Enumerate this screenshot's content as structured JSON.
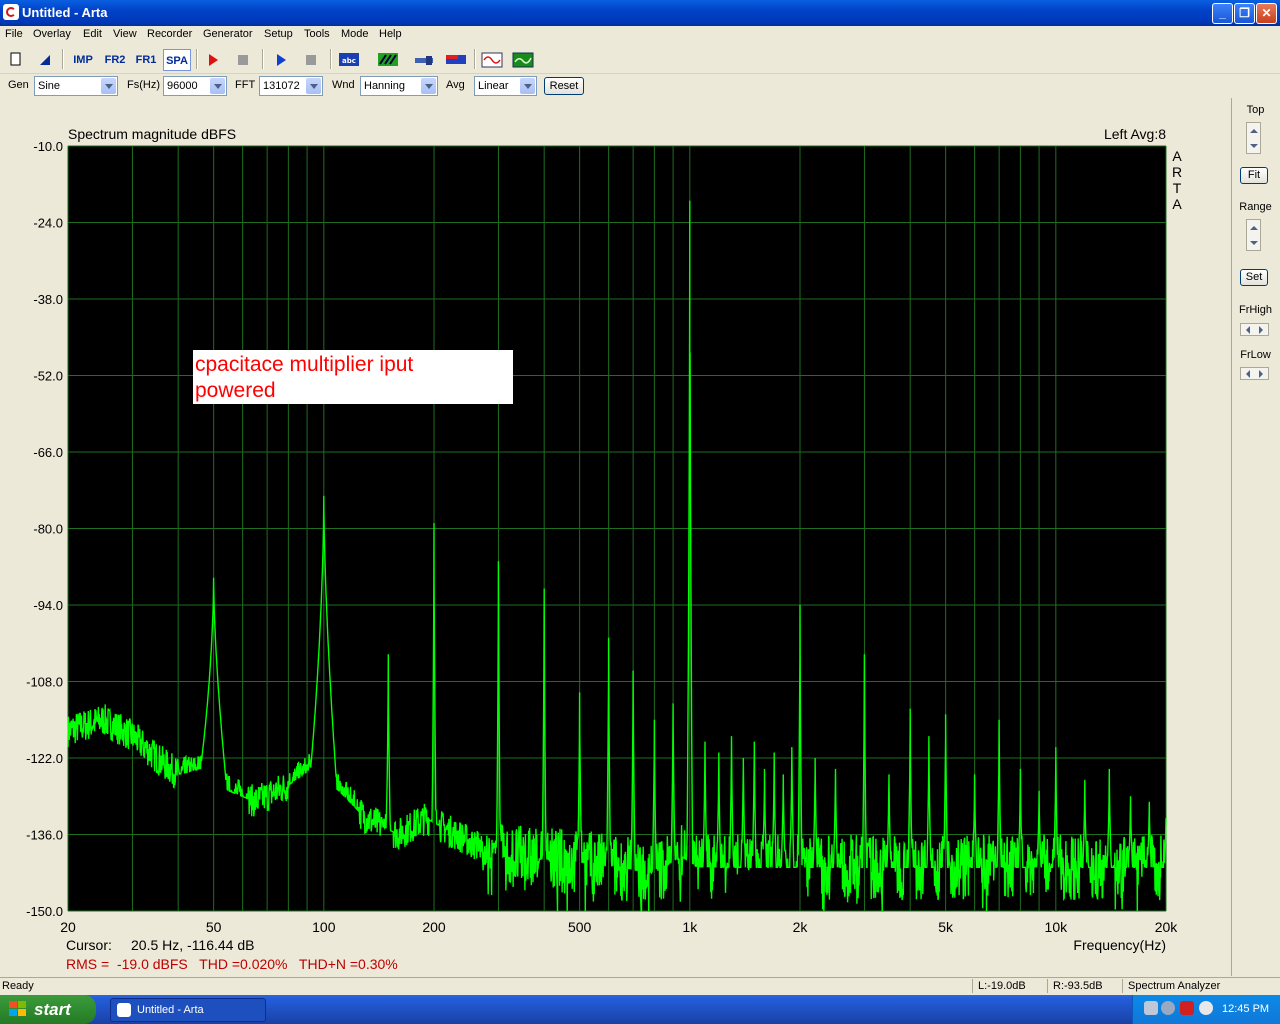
{
  "window": {
    "title": "Untitled - Arta",
    "minimize_glyph": "_",
    "restore_glyph": "❐",
    "close_glyph": "✕"
  },
  "menu": [
    "File",
    "Overlay",
    "Edit",
    "View",
    "Recorder",
    "Generator",
    "Setup",
    "Tools",
    "Mode",
    "Help"
  ],
  "toolbar": {
    "imp_label": "IMP",
    "fr2_label": "FR2",
    "fr1_label": "FR1",
    "spa_label": "SPA",
    "icons": [
      "new-icon",
      "open-icon",
      "imp-icon",
      "fr2-icon",
      "fr1-icon",
      "spa-icon",
      "record-icon",
      "stop-icon",
      "play-icon",
      "stop2-icon",
      "abc-icon",
      "grid-icon",
      "probe-icon",
      "level-icon",
      "wave-icon",
      "scope-icon"
    ]
  },
  "controls": {
    "gen_label": "Gen",
    "gen_value": "Sine",
    "fs_label": "Fs(Hz)",
    "fs_value": "96000",
    "fft_label": "FFT",
    "fft_value": "131072",
    "wnd_label": "Wnd",
    "wnd_value": "Hanning",
    "avg_label": "Avg",
    "avg_value": "Linear",
    "reset_label": "Reset"
  },
  "right_panel": {
    "top_label": "Top",
    "fit_label": "Fit",
    "range_label": "Range",
    "set_label": "Set",
    "frhigh_label": "FrHigh",
    "frlow_label": "FrLow"
  },
  "chart_data": {
    "type": "line",
    "title": "Spectrum magnitude dBFS",
    "channel_info": "Left  Avg:8",
    "watermark": "ARTA",
    "annotation": {
      "line1": "cpacitace multiplier iput",
      "line2": "powered"
    },
    "xlabel": "Frequency(Hz)",
    "xscale": "log",
    "xlim": [
      20,
      20000
    ],
    "ylim": [
      -150,
      -10
    ],
    "yticks": [
      "-10.0",
      "-24.0",
      "-38.0",
      "-52.0",
      "-66.0",
      "-80.0",
      "-94.0",
      "-108.0",
      "-122.0",
      "-136.0",
      "-150.0"
    ],
    "xticks": [
      {
        "v": 20,
        "label": "20"
      },
      {
        "v": 50,
        "label": "50"
      },
      {
        "v": 100,
        "label": "100"
      },
      {
        "v": 200,
        "label": "200"
      },
      {
        "v": 500,
        "label": "500"
      },
      {
        "v": 1000,
        "label": "1k"
      },
      {
        "v": 2000,
        "label": "2k"
      },
      {
        "v": 5000,
        "label": "5k"
      },
      {
        "v": 10000,
        "label": "10k"
      },
      {
        "v": 20000,
        "label": "20k"
      }
    ],
    "grid": true,
    "peaks": [
      {
        "f": 50,
        "db": -89
      },
      {
        "f": 100,
        "db": -74
      },
      {
        "f": 150,
        "db": -103
      },
      {
        "f": 200,
        "db": -79
      },
      {
        "f": 300,
        "db": -86
      },
      {
        "f": 400,
        "db": -91
      },
      {
        "f": 500,
        "db": -110
      },
      {
        "f": 600,
        "db": -100
      },
      {
        "f": 700,
        "db": -106
      },
      {
        "f": 800,
        "db": -115
      },
      {
        "f": 900,
        "db": -112
      },
      {
        "f": 1000,
        "db": -20
      },
      {
        "f": 1100,
        "db": -119
      },
      {
        "f": 1200,
        "db": -121
      },
      {
        "f": 1300,
        "db": -118
      },
      {
        "f": 1400,
        "db": -122
      },
      {
        "f": 1500,
        "db": -119
      },
      {
        "f": 1600,
        "db": -124
      },
      {
        "f": 1700,
        "db": -121
      },
      {
        "f": 1800,
        "db": -125
      },
      {
        "f": 1900,
        "db": -120
      },
      {
        "f": 2000,
        "db": -94
      },
      {
        "f": 2200,
        "db": -122
      },
      {
        "f": 2500,
        "db": -124
      },
      {
        "f": 3000,
        "db": -103
      },
      {
        "f": 3500,
        "db": -125
      },
      {
        "f": 4000,
        "db": -113
      },
      {
        "f": 4500,
        "db": -118
      },
      {
        "f": 5000,
        "db": -114
      },
      {
        "f": 6000,
        "db": -125
      },
      {
        "f": 7000,
        "db": -115
      },
      {
        "f": 8000,
        "db": -124
      },
      {
        "f": 9000,
        "db": -128
      },
      {
        "f": 10000,
        "db": -120
      },
      {
        "f": 12000,
        "db": -126
      },
      {
        "f": 14000,
        "db": -124
      },
      {
        "f": 16000,
        "db": -129
      },
      {
        "f": 18000,
        "db": -130
      },
      {
        "f": 20000,
        "db": -133
      }
    ],
    "mains_secondary": [
      {
        "f": 1000,
        "db": -68
      }
    ],
    "floor": [
      {
        "f": 20,
        "db": -117
      },
      {
        "f": 25,
        "db": -115
      },
      {
        "f": 30,
        "db": -118
      },
      {
        "f": 35,
        "db": -122
      },
      {
        "f": 40,
        "db": -125
      },
      {
        "f": 46,
        "db": -124
      },
      {
        "f": 55,
        "db": -128
      },
      {
        "f": 65,
        "db": -130
      },
      {
        "f": 80,
        "db": -127
      },
      {
        "f": 92,
        "db": -124
      },
      {
        "f": 110,
        "db": -128
      },
      {
        "f": 130,
        "db": -133
      },
      {
        "f": 160,
        "db": -136
      },
      {
        "f": 190,
        "db": -133
      },
      {
        "f": 230,
        "db": -136
      },
      {
        "f": 300,
        "db": -140
      },
      {
        "f": 500,
        "db": -141
      },
      {
        "f": 800,
        "db": -143
      },
      {
        "f": 950,
        "db": -140
      },
      {
        "f": 1050,
        "db": -142
      },
      {
        "f": 2000,
        "db": -142
      },
      {
        "f": 5000,
        "db": -142
      },
      {
        "f": 10000,
        "db": -142
      },
      {
        "f": 20000,
        "db": -142
      }
    ],
    "cursor_label": "Cursor:",
    "cursor_value": "20.5 Hz, -116.44 dB",
    "measurements": "RMS =  -19.0 dBFS   THD =0.020%   THD+N =0.30%",
    "colors": {
      "background": "#000000",
      "grid": "#1e6e1e",
      "trace": "#00ff00",
      "axis_text": "#000000",
      "measure_text": "#c00000",
      "annotation_text": "#ff0000"
    }
  },
  "status": {
    "ready": "Ready",
    "left_level": "L:-19.0dB",
    "right_level": "R:-93.5dB",
    "mode": "Spectrum Analyzer"
  },
  "taskbar": {
    "start_label": "start",
    "task_label": "Untitled - Arta",
    "clock": "12:45 PM"
  }
}
